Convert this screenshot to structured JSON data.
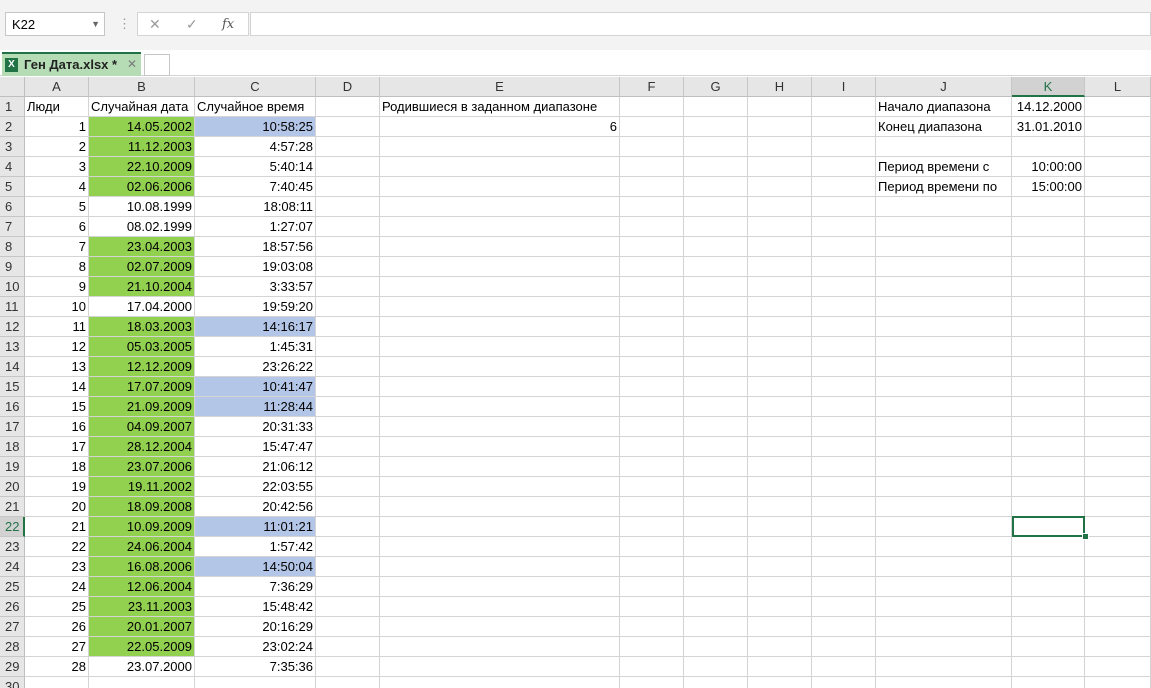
{
  "formula_bar": {
    "name_box": "K22",
    "cancel_icon": "✕",
    "enter_icon": "✓",
    "fx_label": "fx",
    "formula": ""
  },
  "workbook": {
    "tab_name": "Ген Дата.xlsx *",
    "close": "✕",
    "icon_letter": "X"
  },
  "columns": [
    "A",
    "B",
    "C",
    "D",
    "E",
    "F",
    "G",
    "H",
    "I",
    "J",
    "K",
    "L"
  ],
  "selected_column": "K",
  "selected_row": 22,
  "headers": {
    "a": "Люди",
    "b": "Случайная дата",
    "c": "Случайное время",
    "e": "Родившиеся в заданном диапазоне",
    "e_result": "6"
  },
  "params": [
    {
      "label": "Начало диапазона",
      "value": "14.12.2000"
    },
    {
      "label": "Конец диапазона",
      "value": "31.01.2010"
    },
    {
      "label": "",
      "value": ""
    },
    {
      "label": "Период времени с",
      "value": "10:00:00"
    },
    {
      "label": "Период времени по",
      "value": "15:00:00"
    }
  ],
  "rows": [
    {
      "n": "1",
      "date": "14.05.2002",
      "time": "10:58:25",
      "date_hl": true,
      "time_hl": true
    },
    {
      "n": "2",
      "date": "11.12.2003",
      "time": "4:57:28",
      "date_hl": true,
      "time_hl": false
    },
    {
      "n": "3",
      "date": "22.10.2009",
      "time": "5:40:14",
      "date_hl": true,
      "time_hl": false
    },
    {
      "n": "4",
      "date": "02.06.2006",
      "time": "7:40:45",
      "date_hl": true,
      "time_hl": false
    },
    {
      "n": "5",
      "date": "10.08.1999",
      "time": "18:08:11",
      "date_hl": false,
      "time_hl": false
    },
    {
      "n": "6",
      "date": "08.02.1999",
      "time": "1:27:07",
      "date_hl": false,
      "time_hl": false
    },
    {
      "n": "7",
      "date": "23.04.2003",
      "time": "18:57:56",
      "date_hl": true,
      "time_hl": false
    },
    {
      "n": "8",
      "date": "02.07.2009",
      "time": "19:03:08",
      "date_hl": true,
      "time_hl": false
    },
    {
      "n": "9",
      "date": "21.10.2004",
      "time": "3:33:57",
      "date_hl": true,
      "time_hl": false
    },
    {
      "n": "10",
      "date": "17.04.2000",
      "time": "19:59:20",
      "date_hl": false,
      "time_hl": false
    },
    {
      "n": "11",
      "date": "18.03.2003",
      "time": "14:16:17",
      "date_hl": true,
      "time_hl": true
    },
    {
      "n": "12",
      "date": "05.03.2005",
      "time": "1:45:31",
      "date_hl": true,
      "time_hl": false
    },
    {
      "n": "13",
      "date": "12.12.2009",
      "time": "23:26:22",
      "date_hl": true,
      "time_hl": false
    },
    {
      "n": "14",
      "date": "17.07.2009",
      "time": "10:41:47",
      "date_hl": true,
      "time_hl": true
    },
    {
      "n": "15",
      "date": "21.09.2009",
      "time": "11:28:44",
      "date_hl": true,
      "time_hl": true
    },
    {
      "n": "16",
      "date": "04.09.2007",
      "time": "20:31:33",
      "date_hl": true,
      "time_hl": false
    },
    {
      "n": "17",
      "date": "28.12.2004",
      "time": "15:47:47",
      "date_hl": true,
      "time_hl": false
    },
    {
      "n": "18",
      "date": "23.07.2006",
      "time": "21:06:12",
      "date_hl": true,
      "time_hl": false
    },
    {
      "n": "19",
      "date": "19.11.2002",
      "time": "22:03:55",
      "date_hl": true,
      "time_hl": false
    },
    {
      "n": "20",
      "date": "18.09.2008",
      "time": "20:42:56",
      "date_hl": true,
      "time_hl": false
    },
    {
      "n": "21",
      "date": "10.09.2009",
      "time": "11:01:21",
      "date_hl": true,
      "time_hl": true
    },
    {
      "n": "22",
      "date": "24.06.2004",
      "time": "1:57:42",
      "date_hl": true,
      "time_hl": false
    },
    {
      "n": "23",
      "date": "16.08.2006",
      "time": "14:50:04",
      "date_hl": true,
      "time_hl": true
    },
    {
      "n": "24",
      "date": "12.06.2004",
      "time": "7:36:29",
      "date_hl": true,
      "time_hl": false
    },
    {
      "n": "25",
      "date": "23.11.2003",
      "time": "15:48:42",
      "date_hl": true,
      "time_hl": false
    },
    {
      "n": "26",
      "date": "20.01.2007",
      "time": "20:16:29",
      "date_hl": true,
      "time_hl": false
    },
    {
      "n": "27",
      "date": "22.05.2009",
      "time": "23:02:24",
      "date_hl": true,
      "time_hl": false
    },
    {
      "n": "28",
      "date": "23.07.2000",
      "time": "7:35:36",
      "date_hl": false,
      "time_hl": false
    }
  ],
  "row_numbers": [
    "1",
    "2",
    "3",
    "4",
    "5",
    "6",
    "7",
    "8",
    "9",
    "10",
    "11",
    "12",
    "13",
    "14",
    "15",
    "16",
    "17",
    "18",
    "19",
    "20",
    "21",
    "22",
    "23",
    "24",
    "25",
    "26",
    "27",
    "28",
    "29",
    "30"
  ],
  "colors": {
    "date_highlight": "#92d050",
    "time_highlight": "#b4c6e7",
    "accent": "#217346"
  }
}
